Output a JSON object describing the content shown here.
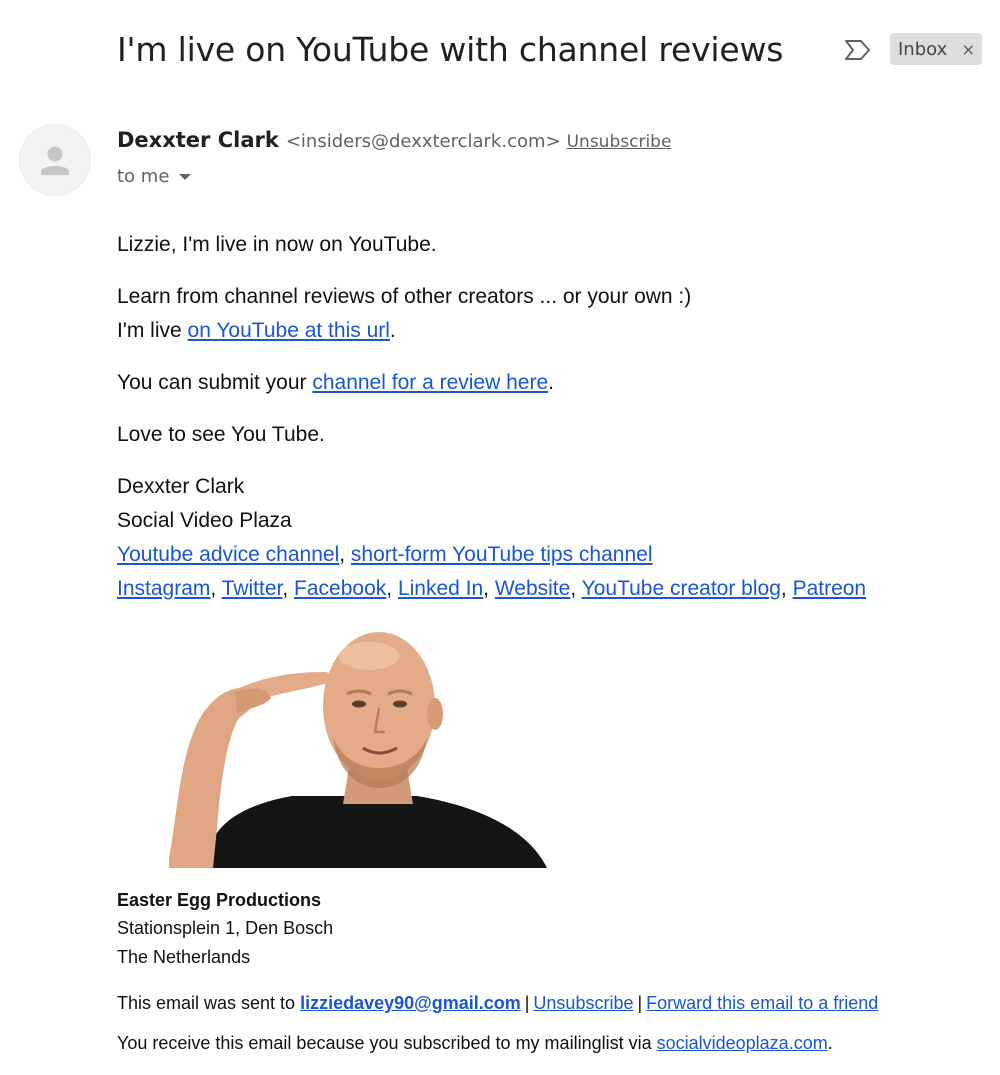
{
  "email": {
    "subject": "I'm live on YouTube with channel reviews",
    "label_chip": {
      "text": "Inbox",
      "remove_glyph": "×"
    },
    "sender": {
      "name": "Dexxter Clark",
      "email": "<insiders@dexxterclark.com>",
      "unsubscribe": "Unsubscribe"
    },
    "recipient": "to me"
  },
  "body": {
    "greeting": "Lizzie, I'm live in now on YouTube.",
    "learn_line": "Learn from channel reviews of other creators ... or your own :)",
    "live_prefix": "I'm live ",
    "live_link": "on YouTube at this url",
    "live_suffix": ".",
    "submit_prefix": "You can submit your ",
    "submit_link": "channel for a review here",
    "submit_suffix": ".",
    "love_line": "Love to see You Tube."
  },
  "signature": {
    "name": "Dexxter Clark",
    "company": "Social Video Plaza",
    "channel_links": [
      "Youtube advice channel",
      "short-form YouTube tips channel"
    ],
    "social_links": [
      "Instagram",
      "Twitter",
      "Facebook",
      "Linked In",
      "Website",
      "YouTube creator blog",
      "Patreon"
    ],
    "separator": ", "
  },
  "footer": {
    "company": "Easter Egg Productions",
    "address_line1": "Stationsplein 1, Den Bosch",
    "address_line2": "The Netherlands",
    "sent_prefix": "This email was sent to ",
    "sent_email": "lizziedavey90@gmail.com",
    "unsubscribe": "Unsubscribe",
    "forward": "Forward this email to a friend",
    "pipe": "|",
    "reason_prefix": "You receive this email because you subscribed to my mailinglist via ",
    "reason_link": "socialvideoplaza.com",
    "reason_suffix": "."
  },
  "icons": {
    "importance": "importance-marker-icon",
    "avatar": "default-person-avatar-icon",
    "caret": "caret-down-icon"
  },
  "colors": {
    "link": "#1a55d6",
    "chip_bg": "#dddddd",
    "meta_text": "#5f6368"
  }
}
